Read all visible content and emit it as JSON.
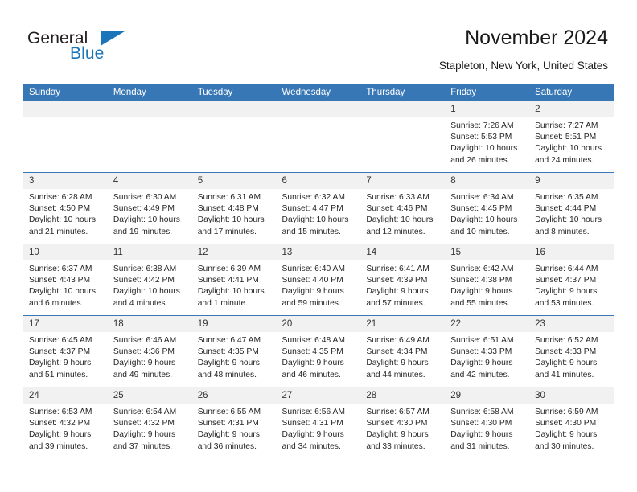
{
  "brand": {
    "name_part1": "General",
    "name_part2": "Blue",
    "accent_color": "#1a75bb",
    "triangle_icon": "triangle-icon"
  },
  "header": {
    "title": "November 2024",
    "subtitle": "Stapleton, New York, United States"
  },
  "calendar": {
    "header_bg": "#3877b5",
    "daynum_bg": "#f1f1f1",
    "weekday_headers": [
      "Sunday",
      "Monday",
      "Tuesday",
      "Wednesday",
      "Thursday",
      "Friday",
      "Saturday"
    ],
    "weeks": [
      [
        {
          "day": "",
          "sunrise": "",
          "sunset": "",
          "daylight_line1": "",
          "daylight_line2": ""
        },
        {
          "day": "",
          "sunrise": "",
          "sunset": "",
          "daylight_line1": "",
          "daylight_line2": ""
        },
        {
          "day": "",
          "sunrise": "",
          "sunset": "",
          "daylight_line1": "",
          "daylight_line2": ""
        },
        {
          "day": "",
          "sunrise": "",
          "sunset": "",
          "daylight_line1": "",
          "daylight_line2": ""
        },
        {
          "day": "",
          "sunrise": "",
          "sunset": "",
          "daylight_line1": "",
          "daylight_line2": ""
        },
        {
          "day": "1",
          "sunrise": "Sunrise: 7:26 AM",
          "sunset": "Sunset: 5:53 PM",
          "daylight_line1": "Daylight: 10 hours",
          "daylight_line2": "and 26 minutes."
        },
        {
          "day": "2",
          "sunrise": "Sunrise: 7:27 AM",
          "sunset": "Sunset: 5:51 PM",
          "daylight_line1": "Daylight: 10 hours",
          "daylight_line2": "and 24 minutes."
        }
      ],
      [
        {
          "day": "3",
          "sunrise": "Sunrise: 6:28 AM",
          "sunset": "Sunset: 4:50 PM",
          "daylight_line1": "Daylight: 10 hours",
          "daylight_line2": "and 21 minutes."
        },
        {
          "day": "4",
          "sunrise": "Sunrise: 6:30 AM",
          "sunset": "Sunset: 4:49 PM",
          "daylight_line1": "Daylight: 10 hours",
          "daylight_line2": "and 19 minutes."
        },
        {
          "day": "5",
          "sunrise": "Sunrise: 6:31 AM",
          "sunset": "Sunset: 4:48 PM",
          "daylight_line1": "Daylight: 10 hours",
          "daylight_line2": "and 17 minutes."
        },
        {
          "day": "6",
          "sunrise": "Sunrise: 6:32 AM",
          "sunset": "Sunset: 4:47 PM",
          "daylight_line1": "Daylight: 10 hours",
          "daylight_line2": "and 15 minutes."
        },
        {
          "day": "7",
          "sunrise": "Sunrise: 6:33 AM",
          "sunset": "Sunset: 4:46 PM",
          "daylight_line1": "Daylight: 10 hours",
          "daylight_line2": "and 12 minutes."
        },
        {
          "day": "8",
          "sunrise": "Sunrise: 6:34 AM",
          "sunset": "Sunset: 4:45 PM",
          "daylight_line1": "Daylight: 10 hours",
          "daylight_line2": "and 10 minutes."
        },
        {
          "day": "9",
          "sunrise": "Sunrise: 6:35 AM",
          "sunset": "Sunset: 4:44 PM",
          "daylight_line1": "Daylight: 10 hours",
          "daylight_line2": "and 8 minutes."
        }
      ],
      [
        {
          "day": "10",
          "sunrise": "Sunrise: 6:37 AM",
          "sunset": "Sunset: 4:43 PM",
          "daylight_line1": "Daylight: 10 hours",
          "daylight_line2": "and 6 minutes."
        },
        {
          "day": "11",
          "sunrise": "Sunrise: 6:38 AM",
          "sunset": "Sunset: 4:42 PM",
          "daylight_line1": "Daylight: 10 hours",
          "daylight_line2": "and 4 minutes."
        },
        {
          "day": "12",
          "sunrise": "Sunrise: 6:39 AM",
          "sunset": "Sunset: 4:41 PM",
          "daylight_line1": "Daylight: 10 hours",
          "daylight_line2": "and 1 minute."
        },
        {
          "day": "13",
          "sunrise": "Sunrise: 6:40 AM",
          "sunset": "Sunset: 4:40 PM",
          "daylight_line1": "Daylight: 9 hours",
          "daylight_line2": "and 59 minutes."
        },
        {
          "day": "14",
          "sunrise": "Sunrise: 6:41 AM",
          "sunset": "Sunset: 4:39 PM",
          "daylight_line1": "Daylight: 9 hours",
          "daylight_line2": "and 57 minutes."
        },
        {
          "day": "15",
          "sunrise": "Sunrise: 6:42 AM",
          "sunset": "Sunset: 4:38 PM",
          "daylight_line1": "Daylight: 9 hours",
          "daylight_line2": "and 55 minutes."
        },
        {
          "day": "16",
          "sunrise": "Sunrise: 6:44 AM",
          "sunset": "Sunset: 4:37 PM",
          "daylight_line1": "Daylight: 9 hours",
          "daylight_line2": "and 53 minutes."
        }
      ],
      [
        {
          "day": "17",
          "sunrise": "Sunrise: 6:45 AM",
          "sunset": "Sunset: 4:37 PM",
          "daylight_line1": "Daylight: 9 hours",
          "daylight_line2": "and 51 minutes."
        },
        {
          "day": "18",
          "sunrise": "Sunrise: 6:46 AM",
          "sunset": "Sunset: 4:36 PM",
          "daylight_line1": "Daylight: 9 hours",
          "daylight_line2": "and 49 minutes."
        },
        {
          "day": "19",
          "sunrise": "Sunrise: 6:47 AM",
          "sunset": "Sunset: 4:35 PM",
          "daylight_line1": "Daylight: 9 hours",
          "daylight_line2": "and 48 minutes."
        },
        {
          "day": "20",
          "sunrise": "Sunrise: 6:48 AM",
          "sunset": "Sunset: 4:35 PM",
          "daylight_line1": "Daylight: 9 hours",
          "daylight_line2": "and 46 minutes."
        },
        {
          "day": "21",
          "sunrise": "Sunrise: 6:49 AM",
          "sunset": "Sunset: 4:34 PM",
          "daylight_line1": "Daylight: 9 hours",
          "daylight_line2": "and 44 minutes."
        },
        {
          "day": "22",
          "sunrise": "Sunrise: 6:51 AM",
          "sunset": "Sunset: 4:33 PM",
          "daylight_line1": "Daylight: 9 hours",
          "daylight_line2": "and 42 minutes."
        },
        {
          "day": "23",
          "sunrise": "Sunrise: 6:52 AM",
          "sunset": "Sunset: 4:33 PM",
          "daylight_line1": "Daylight: 9 hours",
          "daylight_line2": "and 41 minutes."
        }
      ],
      [
        {
          "day": "24",
          "sunrise": "Sunrise: 6:53 AM",
          "sunset": "Sunset: 4:32 PM",
          "daylight_line1": "Daylight: 9 hours",
          "daylight_line2": "and 39 minutes."
        },
        {
          "day": "25",
          "sunrise": "Sunrise: 6:54 AM",
          "sunset": "Sunset: 4:32 PM",
          "daylight_line1": "Daylight: 9 hours",
          "daylight_line2": "and 37 minutes."
        },
        {
          "day": "26",
          "sunrise": "Sunrise: 6:55 AM",
          "sunset": "Sunset: 4:31 PM",
          "daylight_line1": "Daylight: 9 hours",
          "daylight_line2": "and 36 minutes."
        },
        {
          "day": "27",
          "sunrise": "Sunrise: 6:56 AM",
          "sunset": "Sunset: 4:31 PM",
          "daylight_line1": "Daylight: 9 hours",
          "daylight_line2": "and 34 minutes."
        },
        {
          "day": "28",
          "sunrise": "Sunrise: 6:57 AM",
          "sunset": "Sunset: 4:30 PM",
          "daylight_line1": "Daylight: 9 hours",
          "daylight_line2": "and 33 minutes."
        },
        {
          "day": "29",
          "sunrise": "Sunrise: 6:58 AM",
          "sunset": "Sunset: 4:30 PM",
          "daylight_line1": "Daylight: 9 hours",
          "daylight_line2": "and 31 minutes."
        },
        {
          "day": "30",
          "sunrise": "Sunrise: 6:59 AM",
          "sunset": "Sunset: 4:30 PM",
          "daylight_line1": "Daylight: 9 hours",
          "daylight_line2": "and 30 minutes."
        }
      ]
    ]
  }
}
